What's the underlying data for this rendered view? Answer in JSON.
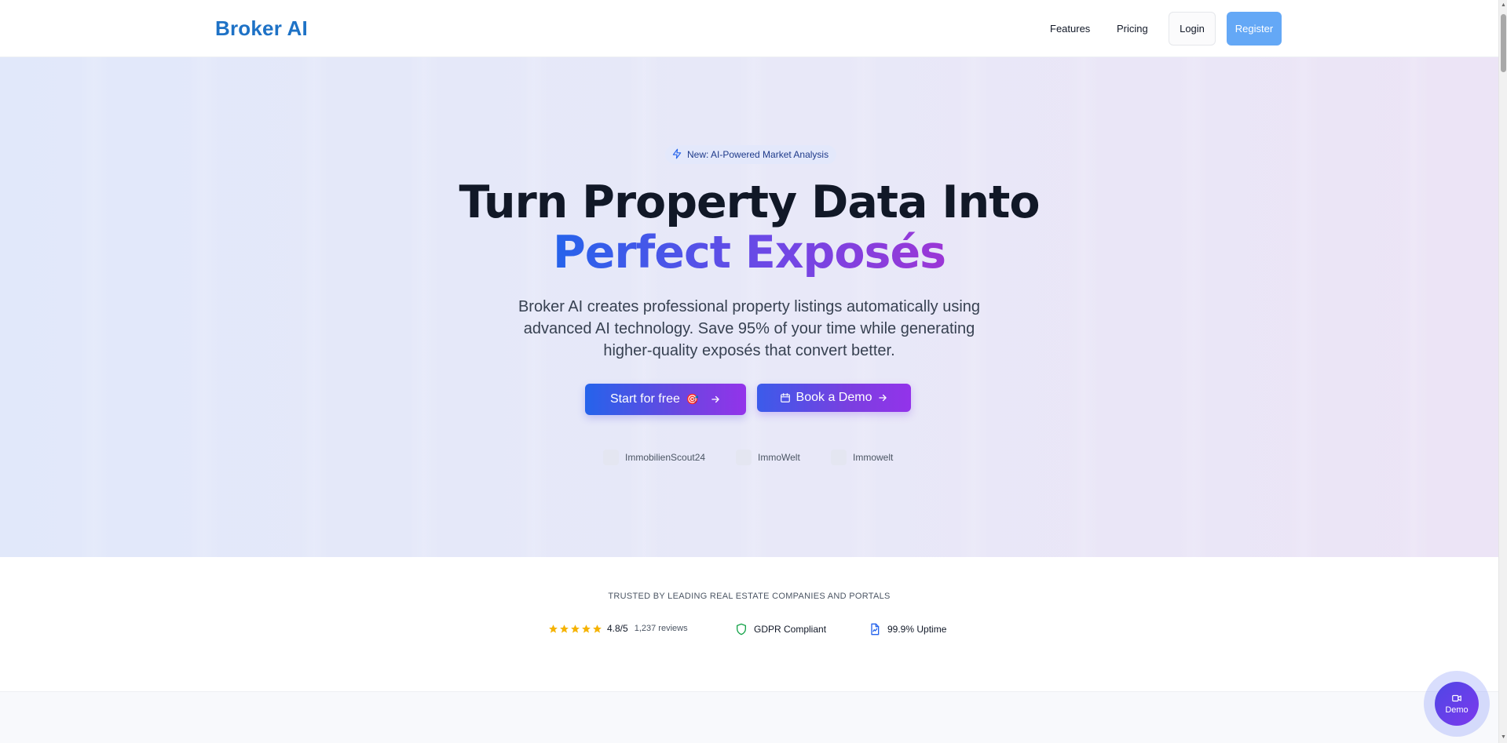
{
  "navbar": {
    "brand": "Broker AI",
    "links": [
      "Features",
      "Pricing"
    ],
    "login_label": "Login",
    "register_label": "Register"
  },
  "hero": {
    "badge_icon": "lightning-icon",
    "badge_text": "New: AI-Powered Market Analysis",
    "headline_line1": "Turn Property Data Into",
    "headline_line2": "Perfect Exposés",
    "subtitle": "Broker AI creates professional property listings automatically using advanced AI technology. Save 95% of your time while generating higher-quality exposés that convert better.",
    "primary_cta": {
      "label": "Start for free",
      "emoji": "🎯",
      "icon": "arrow-right-icon"
    },
    "secondary_cta": {
      "label": "Book a Demo",
      "icon_left": "calendar-icon",
      "icon_right": "arrow-right-icon"
    },
    "portals": [
      "ImmobilienScout24",
      "ImmoWelt",
      "Immowelt"
    ]
  },
  "trust": {
    "heading": "TRUSTED BY LEADING REAL ESTATE COMPANIES AND PORTALS",
    "rating": "4.8/5",
    "reviews": "1,237 reviews",
    "star_count": 5,
    "gdpr": "GDPR Compliant",
    "uptime": "99.9% Uptime"
  },
  "floating_demo": {
    "label": "Demo",
    "icon": "video-icon"
  },
  "colors": {
    "brand": "#1e72c6",
    "register_bg": "#64a8f6",
    "gradient_start": "#2563eb",
    "gradient_end": "#9333ea",
    "star": "#f5b301",
    "gdpr_icon": "#16a34a",
    "uptime_icon": "#2563eb"
  }
}
